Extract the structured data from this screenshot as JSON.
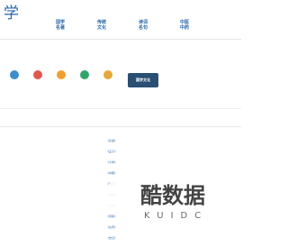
{
  "logo": "学",
  "top_links": [
    "",
    "",
    "",
    "",
    "",
    "",
    "",
    "",
    "",
    ""
  ],
  "nav_groups": [
    {
      "title": "国学名著",
      "links": [
        "",
        "",
        "",
        "",
        "",
        ""
      ]
    },
    {
      "title": "传统文化",
      "links": [
        "",
        "",
        "",
        "",
        "",
        ""
      ]
    },
    {
      "title": "诗词名句",
      "links": [
        "",
        "",
        "",
        "",
        "",
        ""
      ]
    },
    {
      "title": "中医中药",
      "links": [
        "",
        "",
        "",
        "",
        "",
        ""
      ]
    }
  ],
  "categories": [
    {
      "label": "",
      "color": "#3d8ec9"
    },
    {
      "label": "",
      "color": "#e1574c"
    },
    {
      "label": "",
      "color": "#f0a02c"
    },
    {
      "label": "",
      "color": "#30a66b"
    },
    {
      "label": "",
      "color": "#e5a83a"
    }
  ],
  "guoxue_button": "国学文化",
  "rec_links": [
    "",
    "",
    "",
    "",
    "",
    "",
    "",
    "",
    ""
  ],
  "tabs": [
    "",
    ""
  ],
  "books_left": [
    "",
    "",
    "",
    "",
    "",
    "",
    "",
    "",
    ""
  ],
  "books_mid": [
    "《论语》",
    "《孟子》",
    "《大学》",
    "《中庸》",
    "《诗经》",
    "《尚书》",
    "《礼记》",
    "《周易》",
    "《左传》",
    "《史记》"
  ],
  "sidebar": {
    "head1": "",
    "cells1": [
      "",
      "",
      "",
      "",
      "",
      ""
    ],
    "head2": "",
    "cells2": [
      "",
      "",
      "",
      "",
      "",
      ""
    ],
    "head3": ""
  },
  "watermark": {
    "main": "酷数据",
    "sub": "KUIDC"
  }
}
